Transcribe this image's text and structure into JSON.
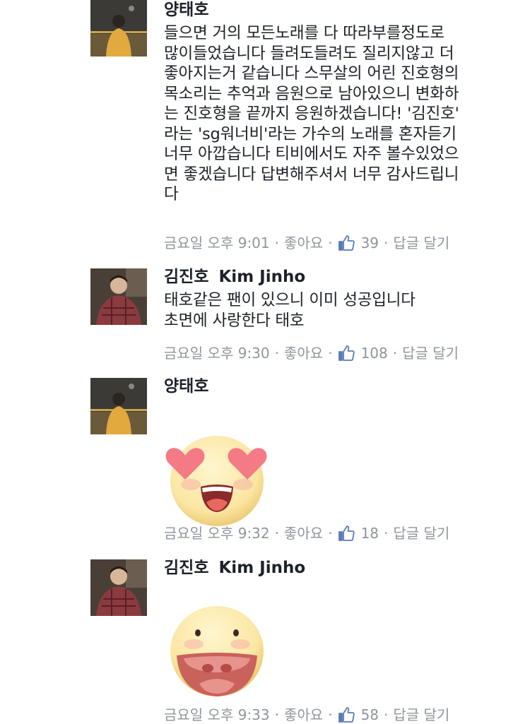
{
  "comments": [
    {
      "author": "양태호",
      "author_sub": "",
      "text": "들으면 거의 모든노래를 다 따라부를정도로\n많이들었습니다 들려도들려도 질리지않고 더\n좋아지는거 같습니다 스무살의 어린 진호형의\n목소리는 추억과 음원으로 남아있으니 변화하\n는 진호형을 끝까지 응원하겠습니다! '김진호'\n라는 'sg워너비'라는 가수의 노래를 혼자듣기\n너무 아깝습니다 티비에서도 자주 볼수있었으\n면 좋겠습니다 답변해주셔서 너무 감사드립니\n다",
      "time": "금요일 오후 9:01",
      "like_label": "좋아요",
      "like_count": "39",
      "reply_label": "답글 달기"
    },
    {
      "author": "김진호",
      "author_sub": "Kim Jinho",
      "text": "태호같은 팬이 있으니 이미 성공입니다\n초면에 사랑한다 태호",
      "time": "금요일 오후 9:30",
      "like_label": "좋아요",
      "like_count": "108",
      "reply_label": "답글 달기"
    },
    {
      "author": "양태호",
      "author_sub": "",
      "sticker": "heart-eyes-emoji",
      "time": "금요일 오후 9:32",
      "like_label": "좋아요",
      "like_count": "18",
      "reply_label": "답글 달기"
    },
    {
      "author": "김진호",
      "author_sub": "Kim Jinho",
      "sticker": "big-smile-emoji",
      "time": "금요일 오후 9:33",
      "like_label": "좋아요",
      "like_count": "58",
      "reply_label": "답글 달기"
    }
  ],
  "colors": {
    "text": "#1d2129",
    "meta": "#90949c",
    "like_icon": "#5b7bb8"
  },
  "icons": {
    "like": "thumbs-up-icon"
  }
}
